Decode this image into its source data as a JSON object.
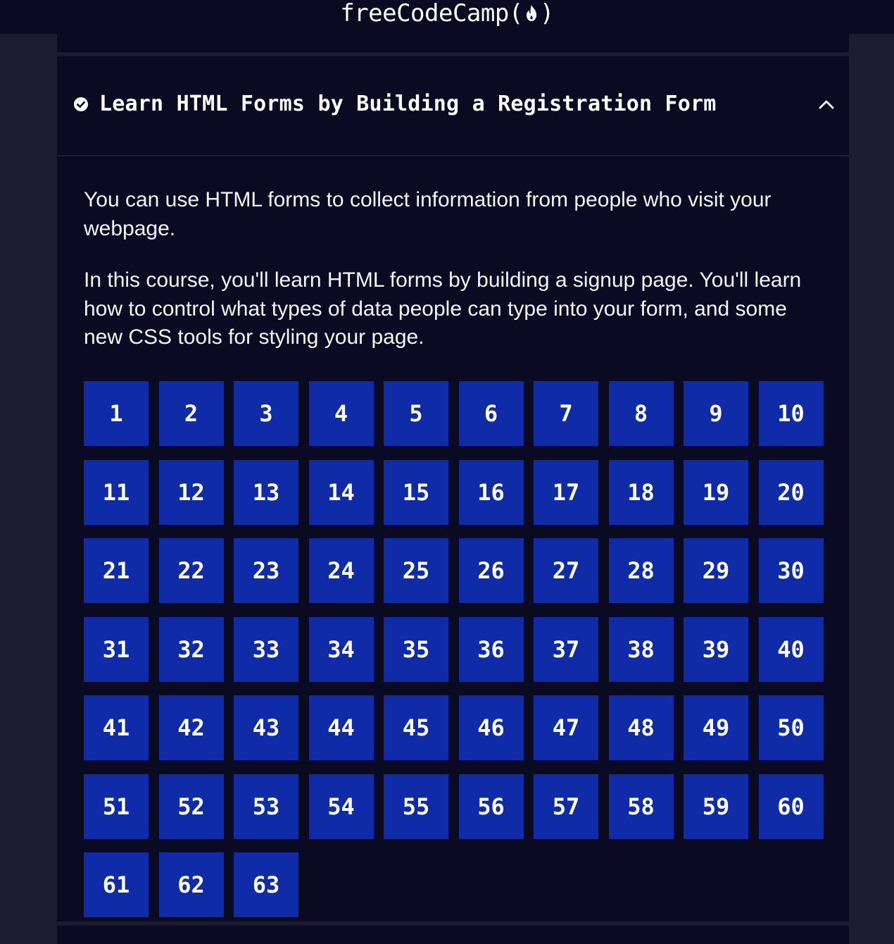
{
  "navbar": {
    "logo_text": "freeCodeCamp",
    "logo_open": "(",
    "logo_close": ")"
  },
  "block": {
    "title": "Learn HTML Forms by Building a Registration Form",
    "completed_icon": "check-circle-icon",
    "toggle_icon": "chevron-up-icon",
    "description": [
      "You can use HTML forms to collect information from people who visit your webpage.",
      "In this course, you'll learn HTML forms by building a signup page. You'll learn how to control what types of data people can type into your form, and some new CSS tools for styling your page."
    ],
    "steps": [
      "1",
      "2",
      "3",
      "4",
      "5",
      "6",
      "7",
      "8",
      "9",
      "10",
      "11",
      "12",
      "13",
      "14",
      "15",
      "16",
      "17",
      "18",
      "19",
      "20",
      "21",
      "22",
      "23",
      "24",
      "25",
      "26",
      "27",
      "28",
      "29",
      "30",
      "31",
      "32",
      "33",
      "34",
      "35",
      "36",
      "37",
      "38",
      "39",
      "40",
      "41",
      "42",
      "43",
      "44",
      "45",
      "46",
      "47",
      "48",
      "49",
      "50",
      "51",
      "52",
      "53",
      "54",
      "55",
      "56",
      "57",
      "58",
      "59",
      "60",
      "61",
      "62",
      "63"
    ]
  },
  "colors": {
    "background": "#1b1b32",
    "panel": "#0a0a23",
    "step_button": "#0f2ba8",
    "text": "#ffffff"
  }
}
